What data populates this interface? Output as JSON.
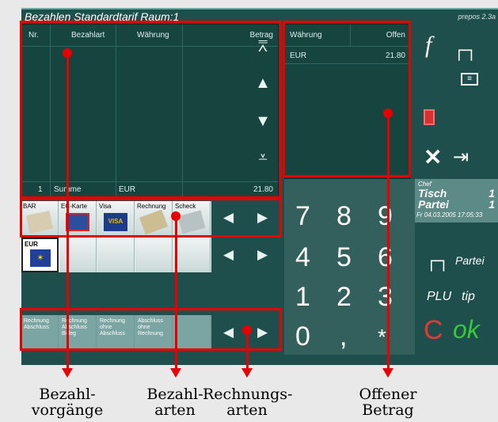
{
  "window": {
    "title": "Bezahlen   Standardtarif   Raum:1",
    "version": "prepos 2.3a"
  },
  "payments_grid": {
    "headers": [
      "Nr.",
      "Bezahlart",
      "Währung",
      "Betrag"
    ],
    "sum_row": {
      "nr": "1",
      "label": "Summe",
      "currency": "EUR",
      "amount": "21.80"
    }
  },
  "open_grid": {
    "headers": [
      "Währung",
      "Offen"
    ],
    "row": {
      "currency": "EUR",
      "amount": "21.80"
    }
  },
  "payment_types": [
    "BAR",
    "EC-Karte",
    "Visa",
    "Rechnung",
    "Scheck"
  ],
  "currency_tiles": [
    "EUR"
  ],
  "invoice_types": [
    "Rechnung Abschluss",
    "Rechnung Abschluss Beleg",
    "Rechnung ohne Abschluss",
    "Abschluss ohne Rechnung"
  ],
  "keypad": [
    "7",
    "8",
    "9",
    "4",
    "5",
    "6",
    "1",
    "2",
    "3",
    "0",
    ",",
    "*"
  ],
  "info": {
    "role": "Chef",
    "table_label": "Tisch",
    "table_value": "1",
    "party_label": "Partei",
    "party_value": "1",
    "datetime": "Fr 04.03.2005 17:05:33"
  },
  "right_buttons": {
    "f": "f",
    "partei": "Partei",
    "plu": "PLU",
    "tip": "tip",
    "c": "C",
    "ok": "ok"
  },
  "annotations": [
    "Bezahl-\nvorgänge",
    "Bezahl-\narten",
    "Rechnungs-\narten",
    "Offener\nBetrag"
  ],
  "colors": {
    "app_bg": "#1f4f4d",
    "panel_bg": "#164540",
    "annotation": "#e60000",
    "ok": "#38c838",
    "c": "#e53935"
  }
}
